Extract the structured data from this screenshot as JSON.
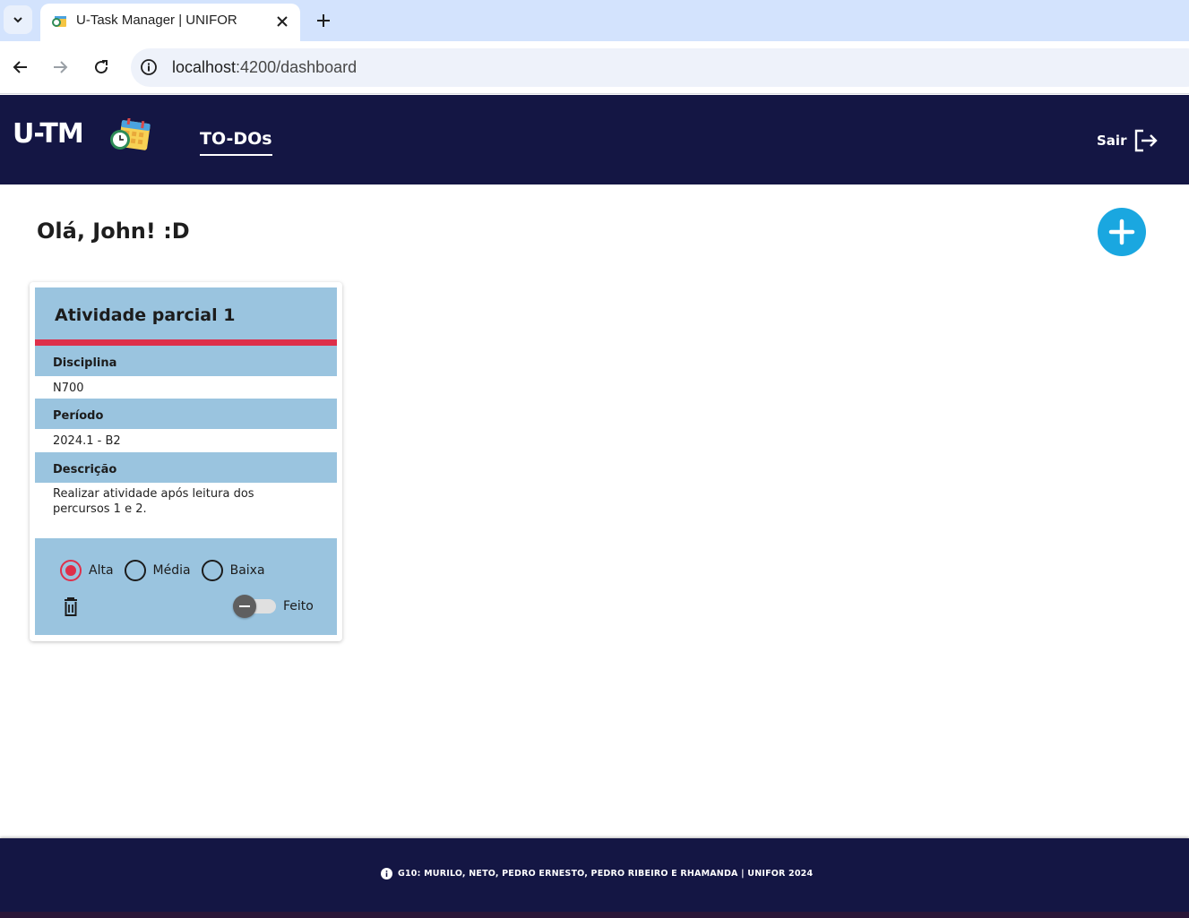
{
  "browser": {
    "tab_title": "U-Task Manager | UNIFOR",
    "url_host": "localhost",
    "url_path": ":4200/dashboard",
    "icons": [
      "chevron-down-icon",
      "close-icon",
      "plus-icon",
      "back-icon",
      "forward-icon",
      "reload-icon",
      "info-icon"
    ]
  },
  "header": {
    "logo": "U-TM",
    "nav_todos": "TO-DOs",
    "logout_label": "Sair",
    "bg_color": "#141644"
  },
  "main": {
    "greeting": "Olá, John! :D",
    "add_button_color": "#1aa7e0"
  },
  "card": {
    "title": "Atividade parcial 1",
    "priority_color": "#de2f4a",
    "fields": [
      {
        "label": "Disciplina",
        "value": "N700"
      },
      {
        "label": "Período",
        "value": "2024.1 - B2"
      },
      {
        "label": "Descrição",
        "value": "Realizar atividade após leitura dos percursos 1 e 2."
      }
    ],
    "priority_options": [
      {
        "label": "Alta",
        "selected": true
      },
      {
        "label": "Média",
        "selected": false
      },
      {
        "label": "Baixa",
        "selected": false
      }
    ],
    "done_label": "Feito",
    "done": false
  },
  "footer": {
    "text": "G10: MURILO, NETO, PEDRO ERNESTO, PEDRO RIBEIRO E RHAMANDA |  UNIFOR 2024"
  }
}
